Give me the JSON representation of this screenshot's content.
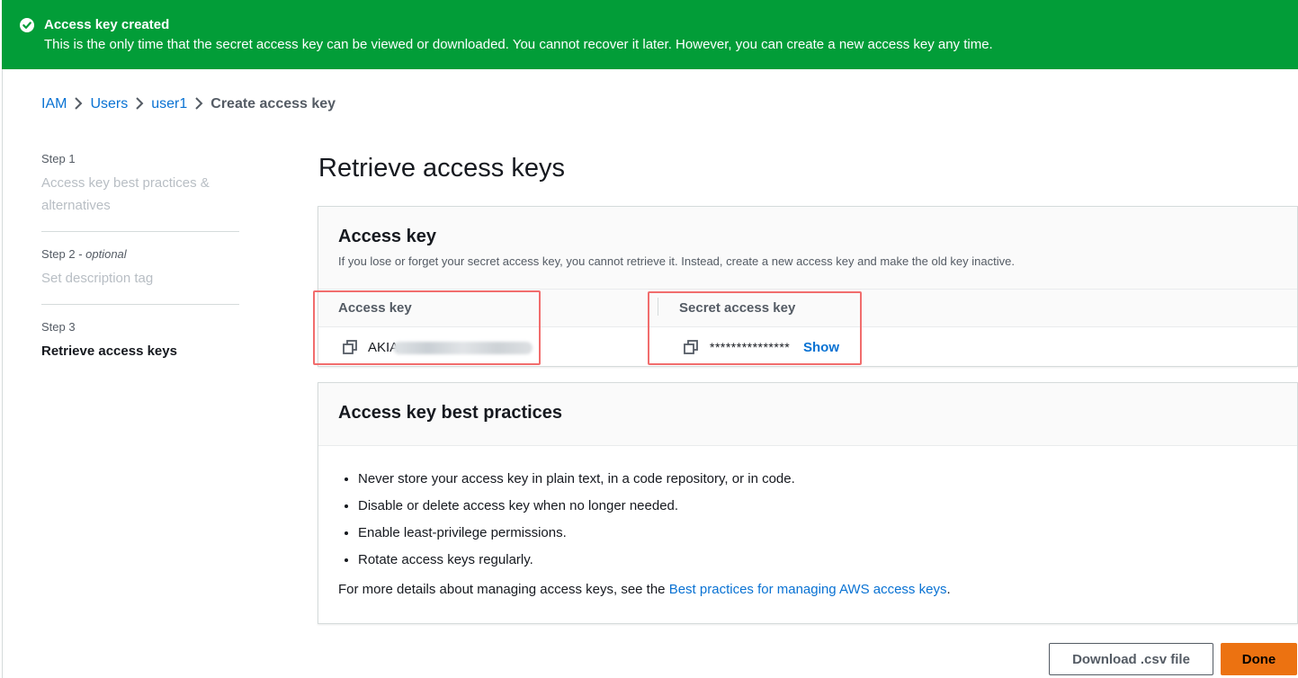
{
  "banner": {
    "title": "Access key created",
    "message": "This is the only time that the secret access key can be viewed or downloaded. You cannot recover it later. However, you can create a new access key any time.",
    "color": "#029d38"
  },
  "breadcrumb": {
    "items": [
      "IAM",
      "Users",
      "user1"
    ],
    "current": "Create access key"
  },
  "steps": [
    {
      "num": "Step 1",
      "optional": "",
      "title": "Access key best practices & alternatives",
      "active": false
    },
    {
      "num": "Step 2 - ",
      "optional": "optional",
      "title": "Set description tag",
      "active": false
    },
    {
      "num": "Step 3",
      "optional": "",
      "title": "Retrieve access keys",
      "active": true
    }
  ],
  "page_title": "Retrieve access keys",
  "access_key_panel": {
    "title": "Access key",
    "description": "If you lose or forget your secret access key, you cannot retrieve it. Instead, create a new access key and make the old key inactive.",
    "col_access_key": "Access key",
    "col_secret_key": "Secret access key",
    "access_key_prefix": "AKIA",
    "secret_masked": "***************",
    "show_label": "Show"
  },
  "best_practices_panel": {
    "title": "Access key best practices",
    "items": [
      "Never store your access key in plain text, in a code repository, or in code.",
      "Disable or delete access key when no longer needed.",
      "Enable least-privilege permissions.",
      "Rotate access keys regularly."
    ],
    "more_prefix": "For more details about managing access keys, see the ",
    "more_link": "Best practices for managing AWS access keys",
    "more_suffix": "."
  },
  "buttons": {
    "download": "Download .csv file",
    "done": "Done"
  },
  "colors": {
    "link": "#0972d3",
    "primary_button": "#ec7211",
    "highlight": "#f16d6d"
  }
}
